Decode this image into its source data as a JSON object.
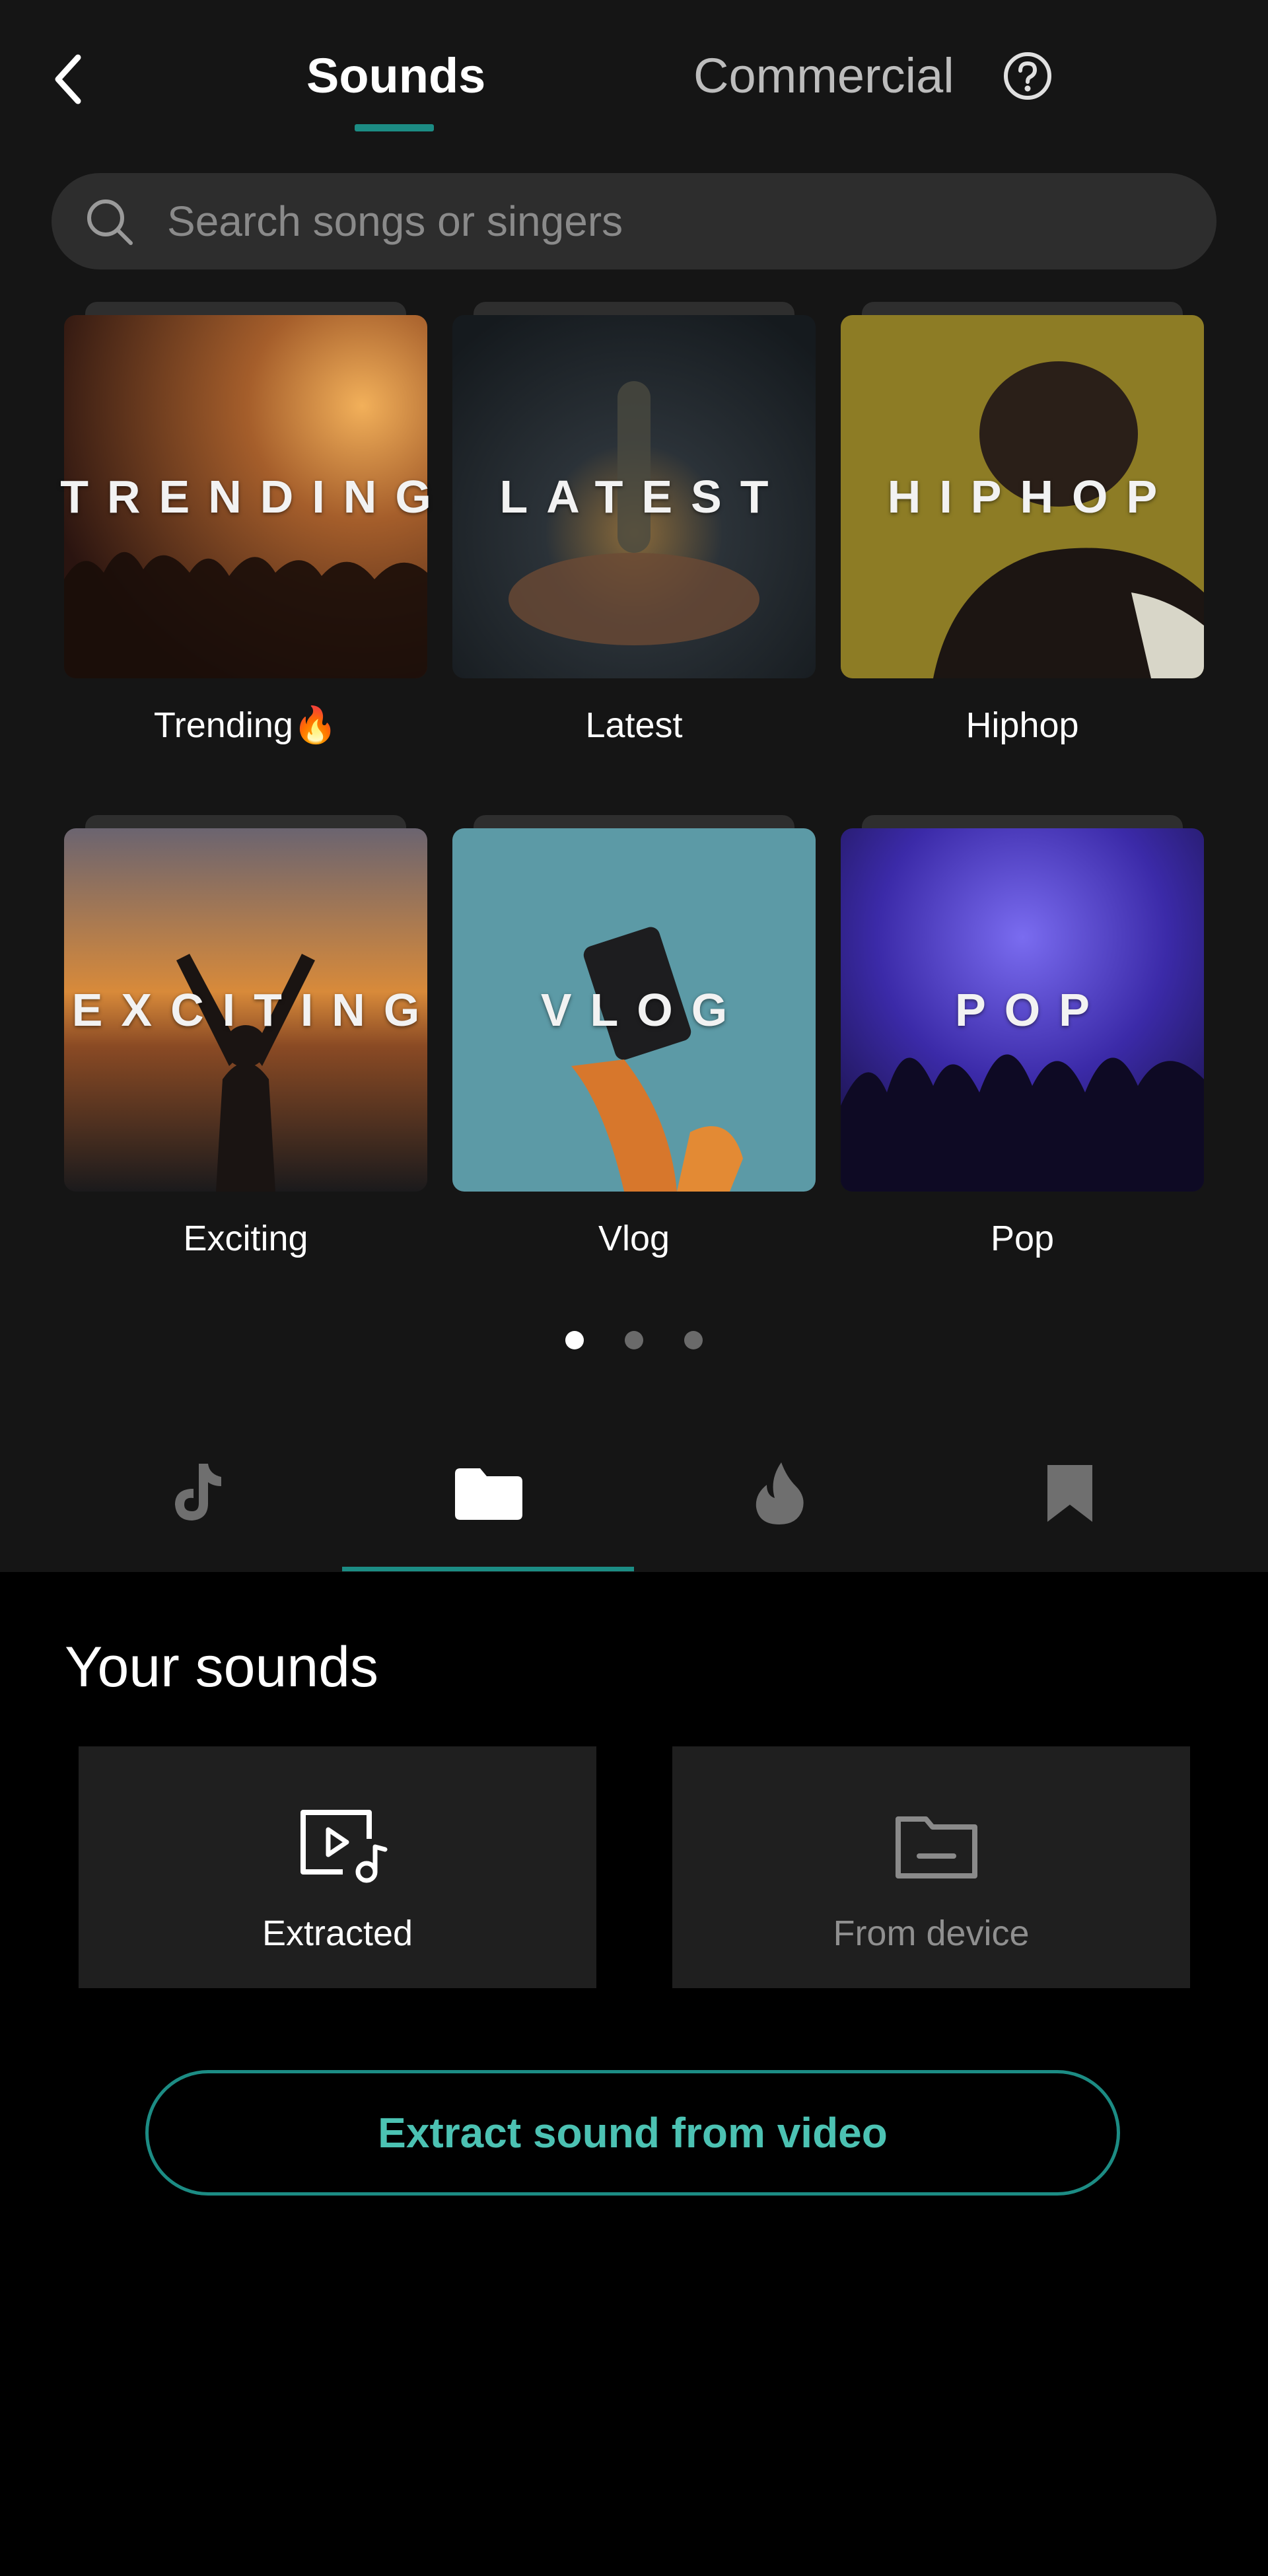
{
  "header": {
    "tabs": [
      {
        "label": "Sounds",
        "active": true
      },
      {
        "label": "Commercial",
        "active": false
      }
    ]
  },
  "search": {
    "placeholder": "Search songs or singers"
  },
  "categories": [
    {
      "label": "Trending🔥",
      "tile_text": "TRENDING"
    },
    {
      "label": "Latest",
      "tile_text": "LATEST"
    },
    {
      "label": "Hiphop",
      "tile_text": "HIPHOP"
    },
    {
      "label": "Exciting",
      "tile_text": "EXCITING"
    },
    {
      "label": "Vlog",
      "tile_text": "VLOG"
    },
    {
      "label": "Pop",
      "tile_text": "POP"
    }
  ],
  "pagination": {
    "pages": 3,
    "current": 1
  },
  "bottom_tabs": [
    {
      "icon": "tiktok-icon",
      "active": false
    },
    {
      "icon": "folder-icon",
      "active": true
    },
    {
      "icon": "flame-icon",
      "active": false
    },
    {
      "icon": "bookmark-icon",
      "active": false
    }
  ],
  "your_sounds": {
    "title": "Your sounds",
    "cards": [
      {
        "label": "Extracted",
        "icon": "video-music-icon"
      },
      {
        "label": "From device",
        "icon": "folder-outline-icon"
      }
    ]
  },
  "extract_button": {
    "label": "Extract sound from video"
  },
  "colors": {
    "accent": "#1c8c84",
    "accent_text": "#4cc2b3",
    "top_background": "#151515",
    "bottom_background": "#000000"
  }
}
